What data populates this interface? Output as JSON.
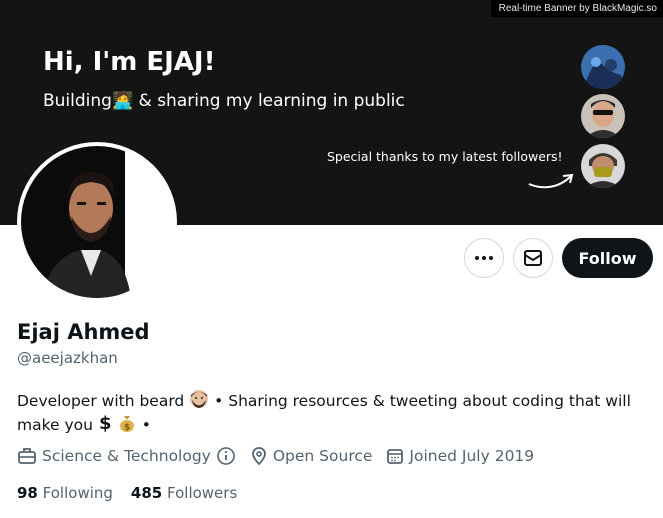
{
  "banner": {
    "credit": "Real-time Banner by BlackMagic.so",
    "headline": "Hi, I'm EJAJ!",
    "tagline": "Building🧑‍💻 & sharing my learning in public",
    "thanks": "Special thanks to my latest followers!",
    "background": "#141414"
  },
  "actions": {
    "more_icon": "ellipsis-icon",
    "message_icon": "mail-icon",
    "follow_label": "Follow"
  },
  "profile": {
    "name": "Ejaj Ahmed",
    "handle": "@aeejazkhan",
    "bio_part1": "Developer with beard",
    "bio_part2": "• Sharing resources & tweeting about coding that will make you",
    "bio_part3": "•",
    "category": "Science & Technology",
    "location": "Open Source",
    "joined": "Joined July 2019"
  },
  "stats": {
    "following_count": "98",
    "following_label": "Following",
    "followers_count": "485",
    "followers_label": "Followers"
  },
  "colors": {
    "primary_text": "#0f1419",
    "secondary_text": "#536471",
    "border": "#cfd9de"
  }
}
